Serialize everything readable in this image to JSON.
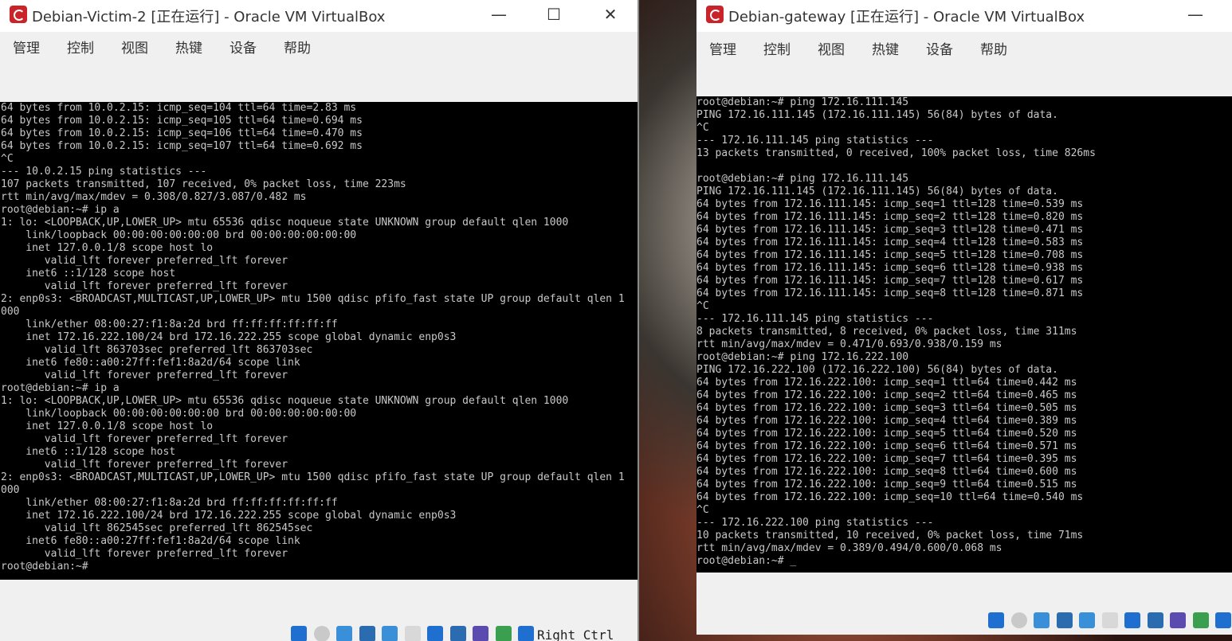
{
  "left": {
    "title": "Debian-Victim-2 [正在运行] - Oracle VM VirtualBox",
    "menu": [
      "管理",
      "控制",
      "视图",
      "热键",
      "设备",
      "帮助"
    ],
    "controls": {
      "minimize": "—",
      "maximize": "☐",
      "close": "✕"
    },
    "host_key": "Right Ctrl",
    "console": [
      "64 bytes from 10.0.2.15: icmp_seq=104 ttl=64 time=2.83 ms",
      "64 bytes from 10.0.2.15: icmp_seq=105 ttl=64 time=0.694 ms",
      "64 bytes from 10.0.2.15: icmp_seq=106 ttl=64 time=0.470 ms",
      "64 bytes from 10.0.2.15: icmp_seq=107 ttl=64 time=0.692 ms",
      "^C",
      "--- 10.0.2.15 ping statistics ---",
      "107 packets transmitted, 107 received, 0% packet loss, time 223ms",
      "rtt min/avg/max/mdev = 0.308/0.827/3.087/0.482 ms",
      "root@debian:~# ip a",
      "1: lo: <LOOPBACK,UP,LOWER_UP> mtu 65536 qdisc noqueue state UNKNOWN group default qlen 1000",
      "    link/loopback 00:00:00:00:00:00 brd 00:00:00:00:00:00",
      "    inet 127.0.0.1/8 scope host lo",
      "       valid_lft forever preferred_lft forever",
      "    inet6 ::1/128 scope host",
      "       valid_lft forever preferred_lft forever",
      "2: enp0s3: <BROADCAST,MULTICAST,UP,LOWER_UP> mtu 1500 qdisc pfifo_fast state UP group default qlen 1",
      "000",
      "    link/ether 08:00:27:f1:8a:2d brd ff:ff:ff:ff:ff:ff",
      "    inet 172.16.222.100/24 brd 172.16.222.255 scope global dynamic enp0s3",
      "       valid_lft 863703sec preferred_lft 863703sec",
      "    inet6 fe80::a00:27ff:fef1:8a2d/64 scope link",
      "       valid_lft forever preferred_lft forever",
      "root@debian:~# ip a",
      "1: lo: <LOOPBACK,UP,LOWER_UP> mtu 65536 qdisc noqueue state UNKNOWN group default qlen 1000",
      "    link/loopback 00:00:00:00:00:00 brd 00:00:00:00:00:00",
      "    inet 127.0.0.1/8 scope host lo",
      "       valid_lft forever preferred_lft forever",
      "    inet6 ::1/128 scope host",
      "       valid_lft forever preferred_lft forever",
      "2: enp0s3: <BROADCAST,MULTICAST,UP,LOWER_UP> mtu 1500 qdisc pfifo_fast state UP group default qlen 1",
      "000",
      "    link/ether 08:00:27:f1:8a:2d brd ff:ff:ff:ff:ff:ff",
      "    inet 172.16.222.100/24 brd 172.16.222.255 scope global dynamic enp0s3",
      "       valid_lft 862545sec preferred_lft 862545sec",
      "    inet6 fe80::a00:27ff:fef1:8a2d/64 scope link",
      "       valid_lft forever preferred_lft forever",
      "root@debian:~#"
    ]
  },
  "right": {
    "title": "Debian-gateway [正在运行] - Oracle VM VirtualBox",
    "menu": [
      "管理",
      "控制",
      "视图",
      "热键",
      "设备",
      "帮助"
    ],
    "controls": {
      "minimize": "—"
    },
    "console": [
      "root@debian:~# ping 172.16.111.145",
      "PING 172.16.111.145 (172.16.111.145) 56(84) bytes of data.",
      "^C",
      "--- 172.16.111.145 ping statistics ---",
      "13 packets transmitted, 0 received, 100% packet loss, time 826ms",
      "",
      "root@debian:~# ping 172.16.111.145",
      "PING 172.16.111.145 (172.16.111.145) 56(84) bytes of data.",
      "64 bytes from 172.16.111.145: icmp_seq=1 ttl=128 time=0.539 ms",
      "64 bytes from 172.16.111.145: icmp_seq=2 ttl=128 time=0.820 ms",
      "64 bytes from 172.16.111.145: icmp_seq=3 ttl=128 time=0.471 ms",
      "64 bytes from 172.16.111.145: icmp_seq=4 ttl=128 time=0.583 ms",
      "64 bytes from 172.16.111.145: icmp_seq=5 ttl=128 time=0.708 ms",
      "64 bytes from 172.16.111.145: icmp_seq=6 ttl=128 time=0.938 ms",
      "64 bytes from 172.16.111.145: icmp_seq=7 ttl=128 time=0.617 ms",
      "64 bytes from 172.16.111.145: icmp_seq=8 ttl=128 time=0.871 ms",
      "^C",
      "--- 172.16.111.145 ping statistics ---",
      "8 packets transmitted, 8 received, 0% packet loss, time 311ms",
      "rtt min/avg/max/mdev = 0.471/0.693/0.938/0.159 ms",
      "root@debian:~# ping 172.16.222.100",
      "PING 172.16.222.100 (172.16.222.100) 56(84) bytes of data.",
      "64 bytes from 172.16.222.100: icmp_seq=1 ttl=64 time=0.442 ms",
      "64 bytes from 172.16.222.100: icmp_seq=2 ttl=64 time=0.465 ms",
      "64 bytes from 172.16.222.100: icmp_seq=3 ttl=64 time=0.505 ms",
      "64 bytes from 172.16.222.100: icmp_seq=4 ttl=64 time=0.389 ms",
      "64 bytes from 172.16.222.100: icmp_seq=5 ttl=64 time=0.520 ms",
      "64 bytes from 172.16.222.100: icmp_seq=6 ttl=64 time=0.571 ms",
      "64 bytes from 172.16.222.100: icmp_seq=7 ttl=64 time=0.395 ms",
      "64 bytes from 172.16.222.100: icmp_seq=8 ttl=64 time=0.600 ms",
      "64 bytes from 172.16.222.100: icmp_seq=9 ttl=64 time=0.515 ms",
      "64 bytes from 172.16.222.100: icmp_seq=10 ttl=64 time=0.540 ms",
      "^C",
      "--- 172.16.222.100 ping statistics ---",
      "10 packets transmitted, 10 received, 0% packet loss, time 71ms",
      "rtt min/avg/max/mdev = 0.389/0.494/0.600/0.068 ms",
      "root@debian:~# _"
    ]
  },
  "status_icons": [
    "hdd-icon",
    "optical-drive-icon",
    "audio-icon",
    "network-icon",
    "usb-icon",
    "shared-folder-icon",
    "display-icon",
    "recording-icon",
    "cpu-icon",
    "mouse-integration-icon",
    "keyboard-capture-icon"
  ],
  "colors": {
    "console_bg": "#000000",
    "console_fg": "#c8c8c8",
    "chrome": "#f0f0f0",
    "accent": "#1f6fd1"
  }
}
